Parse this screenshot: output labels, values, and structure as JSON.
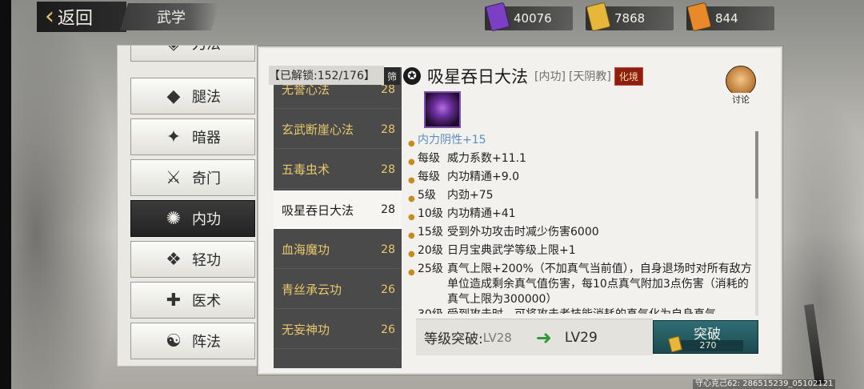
{
  "header": {
    "back_label": "返回",
    "title": "武学",
    "resources": [
      {
        "icon": "purple-token-icon",
        "value": "40076",
        "color": "#7b3fc4"
      },
      {
        "icon": "gold-token-icon",
        "value": "7868",
        "color": "#e7b73a"
      },
      {
        "icon": "orange-token-icon",
        "value": "844",
        "color": "#e98a2a"
      }
    ]
  },
  "categories": [
    {
      "label": "刀法",
      "icon": "blade-icon"
    },
    {
      "label": "腿法",
      "icon": "kick-icon"
    },
    {
      "label": "暗器",
      "icon": "shuriken-icon"
    },
    {
      "label": "奇门",
      "icon": "weapon-icon"
    },
    {
      "label": "内功",
      "icon": "inner-power-icon",
      "active": true
    },
    {
      "label": "轻功",
      "icon": "lightness-icon"
    },
    {
      "label": "医术",
      "icon": "medicine-icon"
    },
    {
      "label": "阵法",
      "icon": "formation-icon"
    }
  ],
  "skill_list": {
    "unlock_text": "【已解锁:152/176】",
    "filter_label": "筛",
    "items": [
      {
        "name": "无誉心法",
        "level": "28"
      },
      {
        "name": "玄武断崖心法",
        "level": "28"
      },
      {
        "name": "五毒虫术",
        "level": "28"
      },
      {
        "name": "吸星吞日大法",
        "level": "28",
        "active": true
      },
      {
        "name": "血海魔功",
        "level": "28"
      },
      {
        "name": "青丝承云功",
        "level": "26"
      },
      {
        "name": "无妄神功",
        "level": "26"
      }
    ]
  },
  "detail": {
    "name": "吸星吞日大法",
    "type_tag": "[内功]",
    "sect_tag": "[天阴教]",
    "realm": "化境",
    "discuss_label": "讨论",
    "effects": [
      {
        "level": "",
        "text": "内力阴性+15"
      },
      {
        "level": "每级",
        "text": "威力系数+11.1"
      },
      {
        "level": "每级",
        "text": "内功精通+9.0"
      },
      {
        "level": "5级",
        "text": "内劲+75"
      },
      {
        "level": "10级",
        "text": "内功精通+41"
      },
      {
        "level": "15级",
        "text": "受到外功攻击时减少伤害6000"
      },
      {
        "level": "20级",
        "text": "日月宝典武学等级上限+1"
      },
      {
        "level": "25级",
        "text": "真气上限+200%（不加真气当前值），自身退场时对所有敌方单位造成剩余真气值伤害，每10点真气附加3点伤害（消耗的真气上限为300000）"
      },
      {
        "level": "30级",
        "text": "受到攻击时，可将攻击者技能消耗的真气化为自身真气"
      }
    ],
    "breakthrough": {
      "label": "等级突破:",
      "from": "LV28",
      "to": "LV29",
      "button_label": "突破",
      "cost": "270"
    }
  },
  "footer_id": "守心克己62: 286515239_05102121"
}
